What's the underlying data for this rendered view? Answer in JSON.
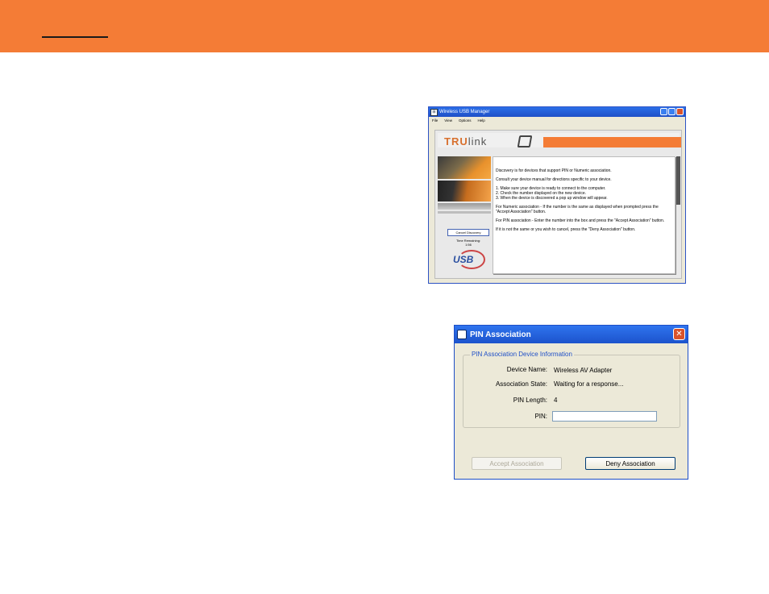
{
  "colors": {
    "banner": "#f47c36",
    "xp_title": "#2b6fe8",
    "accent_orange": "#f47c36"
  },
  "wusb_window": {
    "title": "Wireless USB Manager",
    "menu": [
      "File",
      "View",
      "Options",
      "Help"
    ],
    "logo": {
      "tru": "TRU",
      "link": "link"
    },
    "cancel_button": "Cancel Discovery",
    "time_remaining_label": "Time Remaining:",
    "time_remaining_value": "1:56",
    "usb_logo_text": "USB",
    "instructions": {
      "intro": "Discovery is for devices that support PIN or Numeric association.",
      "consult": "Consult your device manual for directions specific to your device.",
      "steps": [
        "1.  Make sure your device is ready to connect to the computer.",
        "2.  Check the number displayed on the new device.",
        "3.  When the device is discovered a pop up window will appear."
      ],
      "numeric": "For Numeric association - If the number is the same as displayed when prompted press the \"Accept Association\" button.",
      "pin": "For PIN association - Enter the number into the box and press the \"Accept Association\" button.",
      "deny": "If it is not the same or you wish to cancel, press the \"Deny Association\" button."
    }
  },
  "pin_dialog": {
    "title": "PIN Association",
    "group_title": "PIN Association Device Information",
    "fields": {
      "device_name_label": "Device Name:",
      "device_name_value": "Wireless AV Adapter",
      "association_state_label": "Association State:",
      "association_state_value": "Waiting for a response...",
      "pin_length_label": "PIN Length:",
      "pin_length_value": "4",
      "pin_label": "PIN:",
      "pin_value": ""
    },
    "accept_button": "Accept Association",
    "deny_button": "Deny Association"
  }
}
